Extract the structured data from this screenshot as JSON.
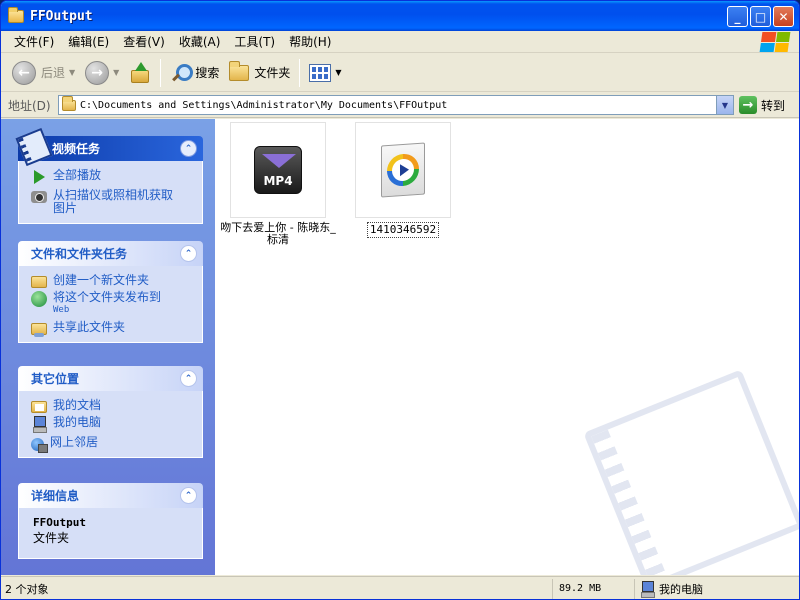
{
  "window": {
    "title": "FFOutput",
    "buttons": {
      "minimize": "_",
      "maximize": "□",
      "close": "✕"
    }
  },
  "menu": [
    "文件(F)",
    "编辑(E)",
    "查看(V)",
    "收藏(A)",
    "工具(T)",
    "帮助(H)"
  ],
  "toolbar": {
    "back": "后退",
    "search": "搜索",
    "folders": "文件夹"
  },
  "address": {
    "label": "地址(D)",
    "path": "C:\\Documents and Settings\\Administrator\\My Documents\\FFOutput",
    "go": "转到"
  },
  "taskpane": {
    "video_tasks": {
      "title": "视频任务",
      "items": [
        "全部播放",
        "从扫描仪或照相机获取图片"
      ]
    },
    "folder_tasks": {
      "title": "文件和文件夹任务",
      "items": [
        "创建一个新文件夹",
        "将这个文件夹发布到",
        "共享此文件夹"
      ],
      "publish_sub": "Web"
    },
    "other_places": {
      "title": "其它位置",
      "items": [
        "我的文档",
        "我的电脑",
        "网上邻居"
      ]
    },
    "details": {
      "title": "详细信息",
      "name": "FFOutput",
      "type": "文件夹"
    }
  },
  "files": [
    {
      "name": "吻下去爱上你 - 陈晓东_标清",
      "icon_label": "MP4",
      "icon": "mp4-icon"
    },
    {
      "name": "1410346592",
      "icon": "wmp-icon"
    }
  ],
  "status": {
    "count": "2 个对象",
    "size": "89.2 MB",
    "zone": "我的电脑"
  },
  "colors": {
    "title_bar": "#0053ee",
    "task_pane": "#6375d6",
    "link": "#215dc6"
  }
}
